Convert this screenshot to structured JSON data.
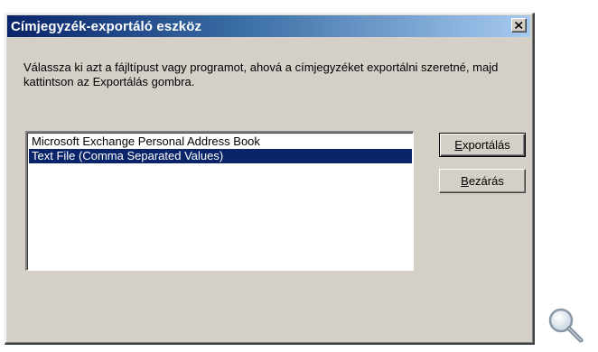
{
  "dialog": {
    "title": "Címjegyzék-exportáló eszköz",
    "instructions": "Válassza ki azt a fájltípust vagy programot, ahová a címjegyzéket exportálni szeretné, majd kattintson az Exportálás gombra.",
    "list": {
      "items": [
        {
          "label": "Microsoft Exchange Personal Address Book",
          "selected": false
        },
        {
          "label": "Text File (Comma Separated Values)",
          "selected": true
        }
      ]
    },
    "buttons": {
      "export": {
        "accel": "E",
        "rest": "xportálás"
      },
      "close": {
        "accel": "B",
        "rest": "ezárás"
      }
    }
  },
  "icons": {
    "close": "close-icon",
    "zoom": "magnifier-icon"
  },
  "colors": {
    "title_start": "#0a246a",
    "title_end": "#a6caf0",
    "selection": "#0a246a",
    "face": "#d4d0c8"
  }
}
